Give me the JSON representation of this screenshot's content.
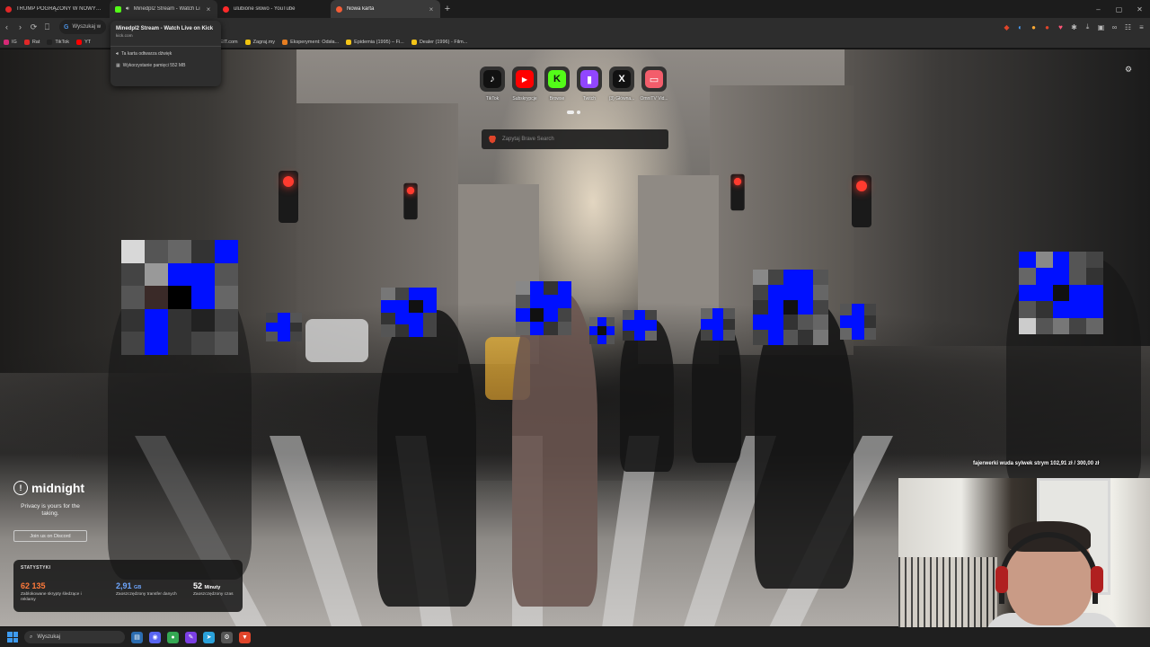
{
  "tabs": [
    {
      "title": "TRUMP POGRĄŻONY W NOWYM W",
      "favicon_color": "#e02828"
    },
    {
      "title": "Minedpl2 Stream - Watch Li",
      "favicon_color": "#53fc18"
    },
    {
      "title": "ulubione słowo - YouTube",
      "favicon_color": "#ff2a2a"
    },
    {
      "title": "Nowa karta",
      "favicon_color": "#f35d36"
    }
  ],
  "tab_close_glyph": "×",
  "new_tab_glyph": "+",
  "window_controls": {
    "minimize": "–",
    "maximize": "▢",
    "close": "✕"
  },
  "omnibox": {
    "text": "Wyszukaj w"
  },
  "bookmarks": [
    {
      "label": "IG",
      "color": "#d62976"
    },
    {
      "label": "Rat",
      "color": "#e02828"
    },
    {
      "label": "TikTok",
      "color": "#222222"
    },
    {
      "label": "YT",
      "color": "#ff0000"
    },
    {
      "label": "ACEIT.com",
      "color": "#f39c12"
    },
    {
      "label": "Zagraj.my",
      "color": "#f1c40f"
    },
    {
      "label": "Eksperyment: Odsła...",
      "color": "#e67e22"
    },
    {
      "label": "Epidemia (1995) – Fi...",
      "color": "#f5c518"
    },
    {
      "label": "Dealer (1996) - Film...",
      "color": "#f5c518"
    }
  ],
  "hover_card": {
    "title": "Minedpl2 Stream - Watch Live on Kick",
    "domain": "kick.com",
    "audio": "Ta karta odtwarza dźwięk",
    "memory": "Wykorzystanie pamięci 552 MB"
  },
  "top_sites": [
    {
      "label": "TikTok",
      "glyph": "♪",
      "bg": "#111111"
    },
    {
      "label": "Subskrypcje",
      "glyph": "▶",
      "bg": "#ff0000"
    },
    {
      "label": "Browse",
      "glyph": "K",
      "bg": "#53fc18"
    },
    {
      "label": "Twitch",
      "glyph": "▮",
      "bg": "#9146ff"
    },
    {
      "label": "(3) Główna...",
      "glyph": "X",
      "bg": "#111111"
    },
    {
      "label": "OmniTV Vid...",
      "glyph": "▭",
      "bg": "#f35d6b"
    }
  ],
  "search": {
    "placeholder": "Zapytaj Brave Search"
  },
  "midnight": {
    "brand": "midnight",
    "tagline": "Privacy is yours for the taking.",
    "discord_button": "Join us on Discord"
  },
  "stats": {
    "heading": "STATYSTYKI",
    "items": [
      {
        "value": "62 135",
        "unit": "",
        "caption": "Zablokowane skrypty śledzące i reklamy",
        "color": "#ff7a3a"
      },
      {
        "value": "2,91",
        "unit": "GB",
        "caption": "Zaoszczędzony transfer danych",
        "color": "#6ea7ff"
      },
      {
        "value": "52",
        "unit": "Minuty",
        "caption": "Zaoszczędzony czas",
        "color": "#ffffff"
      }
    ]
  },
  "stream_goal": "fajerwerki wuda sylwek strym 102,91 zł / 300,00 zł",
  "taskbar": {
    "search_label": "Wyszukaj",
    "apps": [
      {
        "name": "explorer",
        "glyph": "▤",
        "bg": "#2b6cb0"
      },
      {
        "name": "discord",
        "glyph": "◉",
        "bg": "#5865f2"
      },
      {
        "name": "chrome",
        "glyph": "●",
        "bg": "#34a853"
      },
      {
        "name": "pen",
        "glyph": "✎",
        "bg": "#7b3fe4"
      },
      {
        "name": "telegram",
        "glyph": "➤",
        "bg": "#2aa1da"
      },
      {
        "name": "settings",
        "glyph": "⚙",
        "bg": "#555555"
      },
      {
        "name": "brave",
        "glyph": "▼",
        "bg": "#e0452a"
      }
    ]
  }
}
